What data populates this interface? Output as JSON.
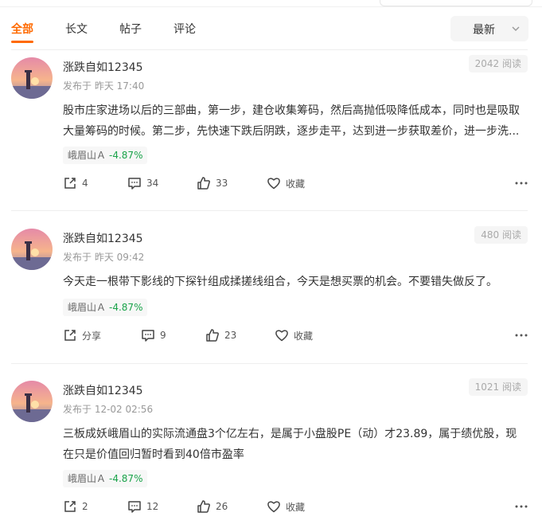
{
  "tabs": [
    {
      "label": "全部",
      "active": true
    },
    {
      "label": "长文",
      "active": false
    },
    {
      "label": "帖子",
      "active": false
    },
    {
      "label": "评论",
      "active": false
    }
  ],
  "sort": {
    "label": "最新"
  },
  "posts": [
    {
      "author": "涨跌自如12345",
      "published": "发布于 昨天 17:40",
      "reads": "2042 阅读",
      "content": "股市庄家进场以后的三部曲，第一步，建仓收集筹码，然后高抛低吸降低成本，同时也是吸取大量筹码的时候。第二步，先快速下跌后阴跌，逐步走平，达到进一步获取差价，进一步洗...",
      "stock_name": "峨眉山Ａ",
      "stock_change": "-4.87%",
      "share": "4",
      "comments": "34",
      "likes": "33",
      "collect": "收藏"
    },
    {
      "author": "涨跌自如12345",
      "published": "发布于 昨天 09:42",
      "reads": "480 阅读",
      "content": "今天走一根带下影线的下探针组成揉搓线组合，今天是想买票的机会。不要错失做反了。",
      "stock_name": "峨眉山Ａ",
      "stock_change": "-4.87%",
      "share": "分享",
      "comments": "9",
      "likes": "23",
      "collect": "收藏"
    },
    {
      "author": "涨跌自如12345",
      "published": "发布于 12-02 02:56",
      "reads": "1021 阅读",
      "content": "三板成妖峨眉山的实际流通盘3个亿左右，是属于小盘股PE（动）才23.89，属于绩优股，现在只是价值回归暂时看到40倍市盈率",
      "stock_name": "峨眉山Ａ",
      "stock_change": "-4.87%",
      "share": "2",
      "comments": "12",
      "likes": "26",
      "collect": "收藏"
    }
  ],
  "colors": {
    "accent": "#ff6a00",
    "stock_down": "#1aa34a"
  }
}
